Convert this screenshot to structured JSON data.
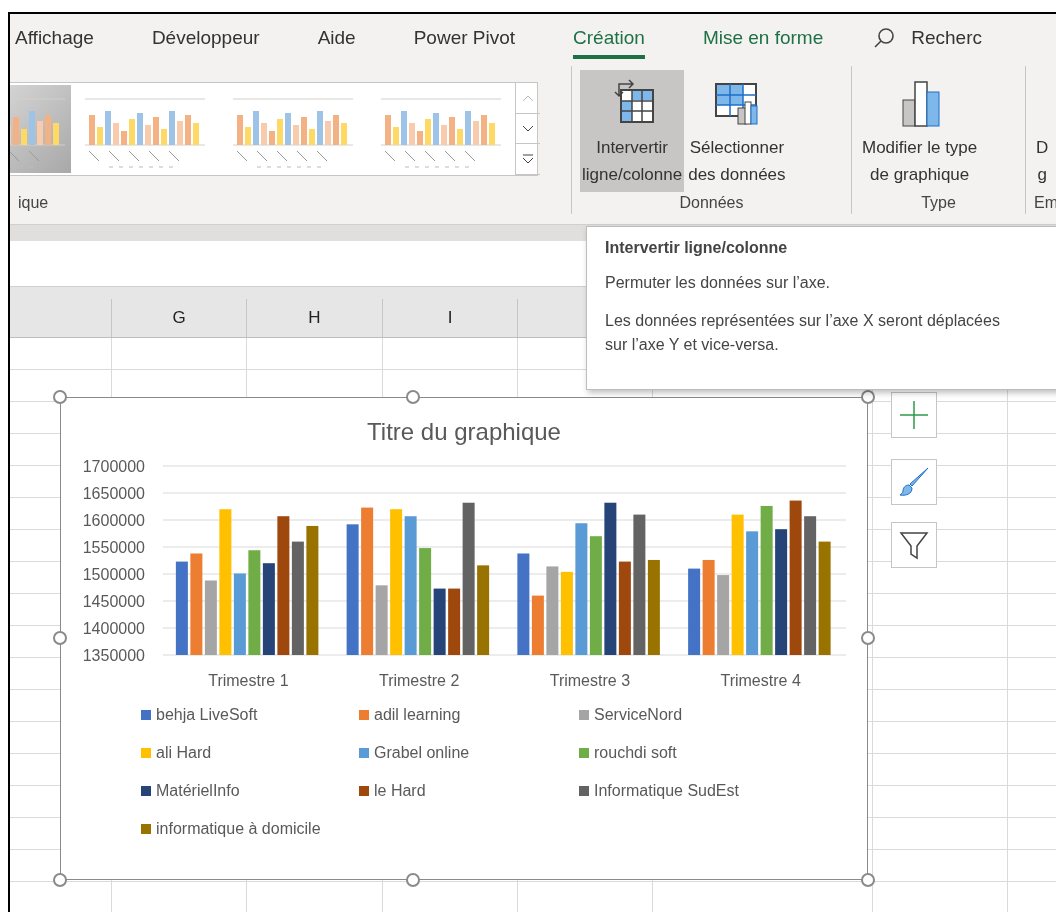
{
  "tabs": [
    {
      "label": "Affichage",
      "selected": false,
      "contextual": false
    },
    {
      "label": "Développeur",
      "selected": false,
      "contextual": false
    },
    {
      "label": "Aide",
      "selected": false,
      "contextual": false
    },
    {
      "label": "Power Pivot",
      "selected": false,
      "contextual": false
    },
    {
      "label": "Création",
      "selected": true,
      "contextual": true
    },
    {
      "label": "Mise en forme",
      "selected": false,
      "contextual": true
    }
  ],
  "search": {
    "label": "Recherc"
  },
  "ribbon": {
    "groups": [
      {
        "kind": "gallery",
        "label": "ique"
      },
      {
        "kind": "buttons",
        "label": "Données",
        "buttons": [
          {
            "lines": [
              "Intervertir",
              "ligne/colonne"
            ],
            "pressed": true
          },
          {
            "lines": [
              "Sélectionner",
              "des données"
            ],
            "pressed": false
          }
        ]
      },
      {
        "kind": "buttons",
        "label": "Type",
        "buttons": [
          {
            "lines": [
              "Modifier le type",
              "de graphique"
            ],
            "pressed": false
          }
        ]
      },
      {
        "kind": "buttons",
        "label": "Em",
        "buttons": [
          {
            "lines": [
              "D",
              "g"
            ],
            "pressed": false
          }
        ]
      }
    ]
  },
  "sheet": {
    "column_headers": [
      "G",
      "H",
      "I"
    ]
  },
  "chart": {
    "chart_data": {
      "type": "bar",
      "title": "Titre du graphique",
      "grid": true,
      "categories": [
        "Trimestre 1",
        "Trimestre 2",
        "Trimestre 3",
        "Trimestre 4"
      ],
      "ylim": [
        1350000,
        1700000
      ],
      "yticks": [
        1350000,
        1400000,
        1450000,
        1500000,
        1550000,
        1600000,
        1650000,
        1700000
      ],
      "series": [
        {
          "name": "behja LiveSoft",
          "color": "#4472c4",
          "values": [
            1523000,
            1592000,
            1538000,
            1510000
          ]
        },
        {
          "name": "adil learning",
          "color": "#ed7d31",
          "values": [
            1538000,
            1623000,
            1460000,
            1526000
          ]
        },
        {
          "name": "ServiceNord",
          "color": "#a5a5a5",
          "values": [
            1488000,
            1479000,
            1514000,
            1498000
          ]
        },
        {
          "name": "ali Hard",
          "color": "#ffc000",
          "values": [
            1620000,
            1620000,
            1504000,
            1610000
          ]
        },
        {
          "name": "Grabel online",
          "color": "#5b9bd5",
          "values": [
            1501000,
            1607000,
            1594000,
            1579000
          ]
        },
        {
          "name": "rouchdi soft",
          "color": "#70ad47",
          "values": [
            1544000,
            1548000,
            1570000,
            1626000
          ]
        },
        {
          "name": "MatérielInfo",
          "color": "#264478",
          "values": [
            1520000,
            1473000,
            1632000,
            1583000
          ]
        },
        {
          "name": "le Hard",
          "color": "#9e480e",
          "values": [
            1607000,
            1473000,
            1523000,
            1636000
          ]
        },
        {
          "name": "Informatique SudEst",
          "color": "#636363",
          "values": [
            1560000,
            1632000,
            1610000,
            1607000
          ]
        },
        {
          "name": "informatique à domicile",
          "color": "#997300",
          "values": [
            1589000,
            1516000,
            1526000,
            1560000
          ]
        }
      ]
    }
  },
  "tooltip": {
    "title": "Intervertir ligne/colonne",
    "lines": [
      "Permuter les données sur l’axe.",
      "Les données représentées sur l’axe X seront déplacées sur l’axe Y et vice-versa."
    ]
  }
}
